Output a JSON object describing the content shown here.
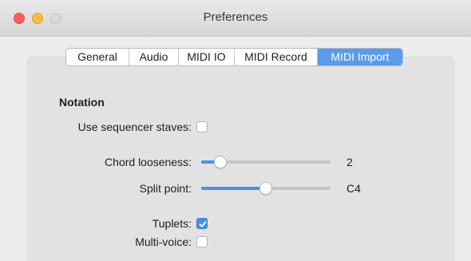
{
  "window": {
    "title": "Preferences"
  },
  "tabs": [
    {
      "label": "General",
      "selected": false
    },
    {
      "label": "Audio",
      "selected": false
    },
    {
      "label": "MIDI IO",
      "selected": false
    },
    {
      "label": "MIDI Record",
      "selected": false
    },
    {
      "label": "MIDI Import",
      "selected": true
    }
  ],
  "notation": {
    "section_title": "Notation",
    "use_sequencer_staves": {
      "label": "Use sequencer staves:",
      "checked": false
    },
    "chord_looseness": {
      "label": "Chord looseness:",
      "value": "2",
      "level_fraction": 0.15
    },
    "split_point": {
      "label": "Split point:",
      "value": "C4",
      "level_fraction": 0.5
    },
    "tuplets": {
      "label": "Tuplets:",
      "checked": true
    },
    "multi_voice": {
      "label": "Multi-voice:",
      "checked": false
    }
  },
  "colors": {
    "accent": "#4a90e8",
    "selected_tab": "#5b9bea",
    "close": "#fc605c",
    "minimize": "#fdbc40",
    "maximize_inactive": "#d9d9d9"
  }
}
